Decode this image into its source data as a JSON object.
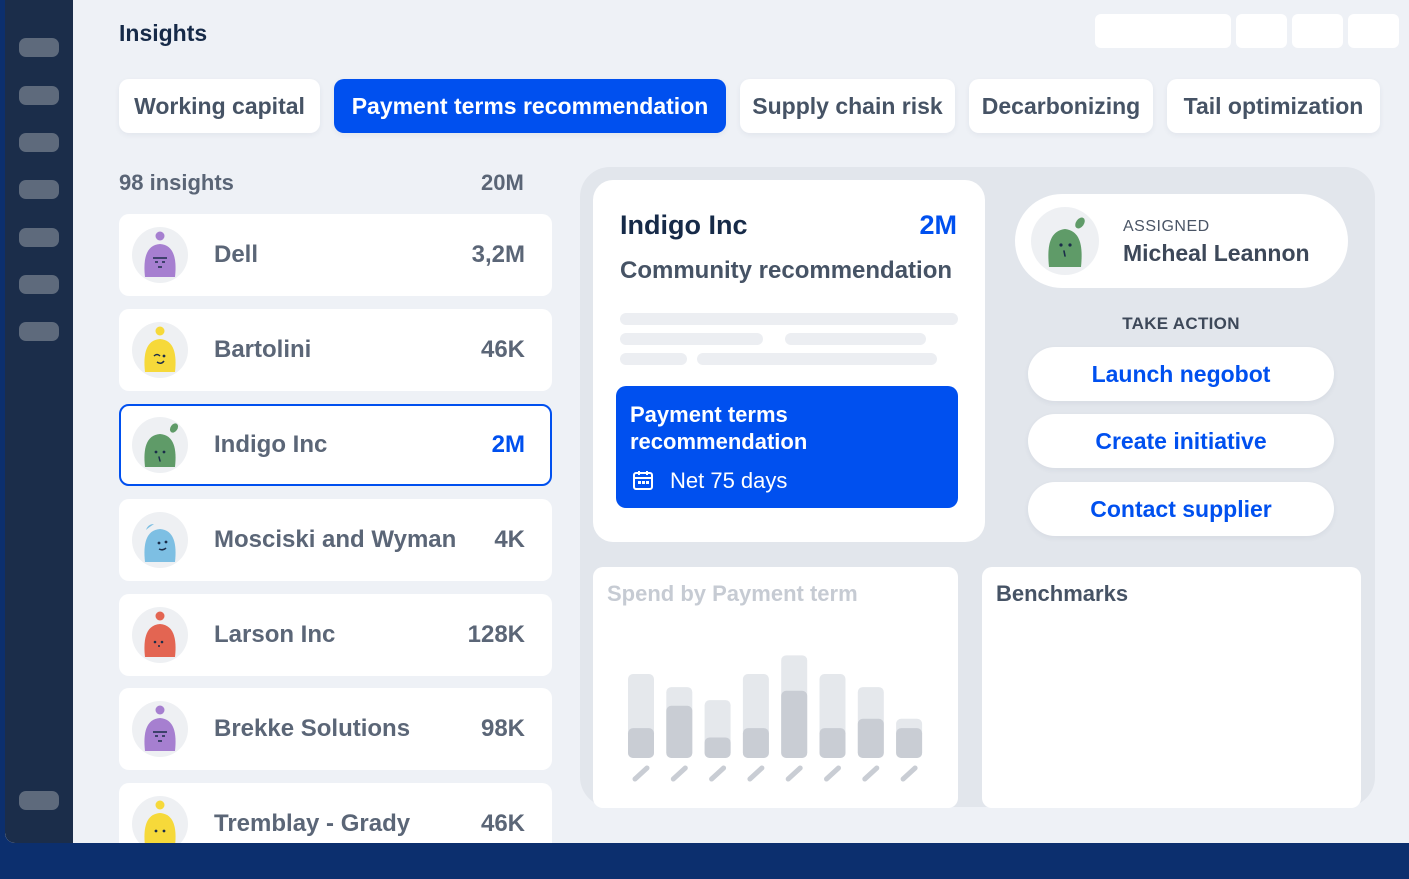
{
  "page": {
    "title": "Insights"
  },
  "tabs": [
    {
      "label": "Working capital",
      "active": false
    },
    {
      "label": "Payment terms recommendation",
      "active": true
    },
    {
      "label": "Supply chain risk",
      "active": false
    },
    {
      "label": "Decarbonizing",
      "active": false
    },
    {
      "label": "Tail optimization",
      "active": false
    }
  ],
  "list": {
    "count_label": "98 insights",
    "total": "20M",
    "items": [
      {
        "name": "Dell",
        "amount": "3,2M",
        "avatar": "purple-sleepy-face-icon",
        "color": "#a67fd0"
      },
      {
        "name": "Bartolini",
        "amount": "46K",
        "avatar": "yellow-happy-face-icon",
        "color": "#f6d93a"
      },
      {
        "name": "Indigo Inc",
        "amount": "2M",
        "avatar": "green-leaf-face-icon",
        "color": "#5f9b68",
        "selected": true
      },
      {
        "name": "Mosciski and Wyman",
        "amount": "4K",
        "avatar": "blue-smile-face-icon",
        "color": "#7dbfe3"
      },
      {
        "name": "Larson Inc",
        "amount": "128K",
        "avatar": "red-face-icon",
        "color": "#e36552"
      },
      {
        "name": "Brekke Solutions",
        "amount": "98K",
        "avatar": "purple-sleepy-face-icon",
        "color": "#a67fd0"
      },
      {
        "name": "Tremblay - Grady",
        "amount": "46K",
        "avatar": "yellow-face-icon",
        "color": "#f6d93a"
      }
    ]
  },
  "detail": {
    "supplier": "Indigo Inc",
    "amount": "2M",
    "subtitle": "Community recommendation",
    "recommendation": {
      "title": "Payment terms recommendation",
      "term": "Net 75 days",
      "icon": "calendar-icon"
    }
  },
  "assigned": {
    "label": "ASSIGNED",
    "name": "Micheal Leannon",
    "avatar": "green-leaf-face-icon"
  },
  "actions": {
    "heading": "TAKE ACTION",
    "buttons": [
      "Launch negobot",
      "Create initiative",
      "Contact supplier"
    ]
  },
  "chart_card": {
    "title": "Spend by Payment term"
  },
  "chart_data": {
    "type": "bar",
    "title": "Spend by Payment term",
    "categories": [
      "",
      "",
      "",
      "",
      "",
      "",
      "",
      ""
    ],
    "series": [
      {
        "values": [
          4.5,
          3.8,
          3.1,
          4.5,
          5.5,
          4.5,
          3.8,
          2.1
        ]
      },
      {
        "values": [
          1.6,
          2.8,
          1.1,
          1.6,
          3.6,
          1.6,
          2.1,
          1.6
        ]
      }
    ],
    "colors": [
      "#e5e8ec",
      "#c9cdd4"
    ],
    "ylim": [
      0,
      6
    ]
  },
  "benchmarks": {
    "title": "Benchmarks"
  },
  "colors": {
    "accent": "#0050ef",
    "sidebar": "#1b2d4a",
    "background": "#eef1f6"
  }
}
